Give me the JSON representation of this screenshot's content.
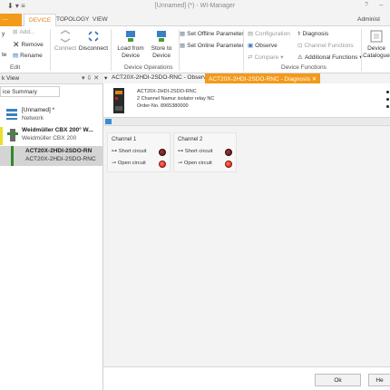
{
  "titlebar": {
    "title": "[Unnamed] (*) - WI-Manager",
    "help": "?",
    "minimize": "–"
  },
  "tabs": {
    "file": "⋯",
    "device": "DEVICE",
    "topology": "TOPOLOGY",
    "view": "VIEW",
    "user": "Administ"
  },
  "ribbon": {
    "edit": {
      "add": "Add...",
      "remove": "Remove",
      "rename": "Rename",
      "group": "Edit",
      "cut_left1": "y",
      "cut_left2": "te"
    },
    "connect": "Connect",
    "disconnect": "Disconnect",
    "load_from_device": [
      "Load from",
      "Device"
    ],
    "store_to_device": [
      "Store to",
      "Device"
    ],
    "device_operations_group": "Device Operations",
    "set_offline": "Set Offline Parameter",
    "set_online": "Set Online Parameter",
    "configuration": "Configuration",
    "observe": "Observe",
    "compare": "Compare",
    "diagnosis": "Diagnosis",
    "channel_functions": "Channel Functions",
    "additional_functions": "Additional Functions",
    "device_functions_group": "Device Functions",
    "device_catalogue": [
      "Device",
      "Catalogue"
    ]
  },
  "leftpane": {
    "title": "k View",
    "controls": "▾ ⇩ ✕",
    "summary": "ice Summary",
    "network_name": "[Unnamed] *",
    "network_label": "Network",
    "gateway_name": "Weidmüller CBX 200° W...",
    "gateway_sub": "Weidmüller CBX 200",
    "module_name": "ACT20X-2HDI-2SDO-RN",
    "module_sub": "ACT20X-2HDI-2SDO-RNC"
  },
  "doctabs": {
    "arrow": "▾",
    "observe": "ACT20X-2HDI-2SDO-RNC - Observe",
    "diagnosis": "ACT20X-2HDI-2SDO-RNC - Diagnosis ✕"
  },
  "device": {
    "name": "ACT20X-2HDI-2SDO-RNC",
    "desc": "2 Channel Namur isolator relay NC",
    "order": "Order-No. 8965380000"
  },
  "channels": [
    {
      "label": "Channel 1",
      "short": "Short circuit",
      "open": "Open circuit",
      "short_state": "off",
      "open_state": "on"
    },
    {
      "label": "Channel 2",
      "short": "Short circuit",
      "open": "Open circuit",
      "short_state": "off",
      "open_state": "on"
    }
  ],
  "buttons": {
    "ok": "Ok",
    "help": "He"
  },
  "colors": {
    "accent": "#f29a1a",
    "led_off": "#6b1111",
    "led_on": "#e0241a"
  }
}
